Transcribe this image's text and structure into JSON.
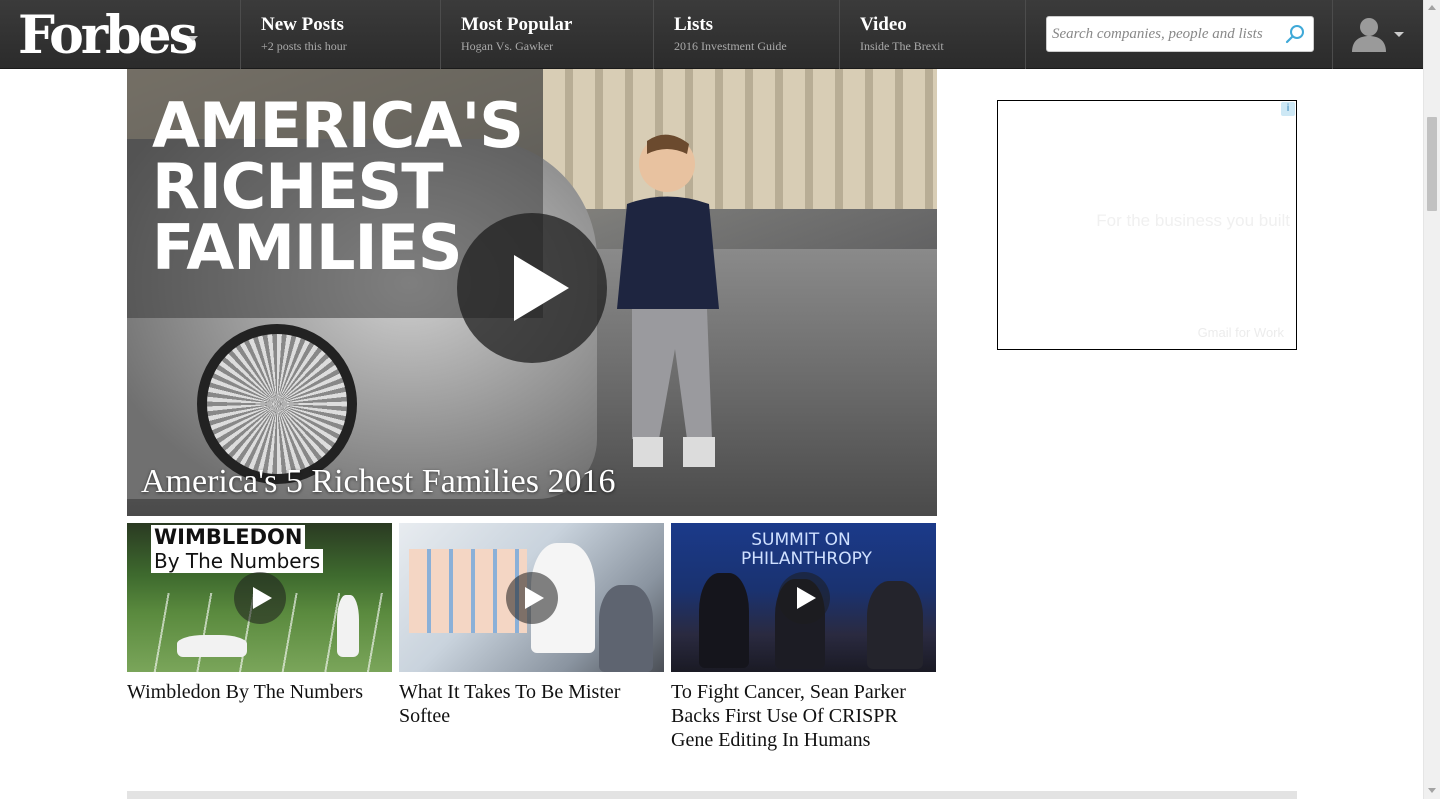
{
  "brand": {
    "logo": "Forbes"
  },
  "nav": {
    "items": [
      {
        "title": "New Posts",
        "sub": "+2 posts this hour"
      },
      {
        "title": "Most Popular",
        "sub": "Hogan Vs. Gawker"
      },
      {
        "title": "Lists",
        "sub": "2016 Investment Guide"
      },
      {
        "title": "Video",
        "sub": "Inside The Brexit"
      }
    ],
    "search_placeholder": "Search companies, people and lists"
  },
  "hero": {
    "heading_lines": [
      "AMERICA'S",
      "RICHEST",
      "FAMILIES"
    ],
    "caption": "America's 5 Richest Families 2016"
  },
  "videos": [
    {
      "caption": "Wimbledon By The Numbers",
      "thumb_title": "WIMBLEDON",
      "thumb_sub": "By The Numbers"
    },
    {
      "caption": "What It Takes To Be Mister Softee"
    },
    {
      "caption": "To Fight Cancer, Sean Parker Backs First Use Of CRISPR Gene Editing In Humans",
      "thumb_title": "SUMMIT ON PHILANTHROPY"
    }
  ],
  "ad": {
    "text": "For the business you built",
    "footer": "Gmail for Work",
    "info_icon": "i"
  },
  "colors": {
    "nav_bg": "#333333",
    "search_icon": "#3fa9d8",
    "ad_info": "#2a7fb8"
  }
}
